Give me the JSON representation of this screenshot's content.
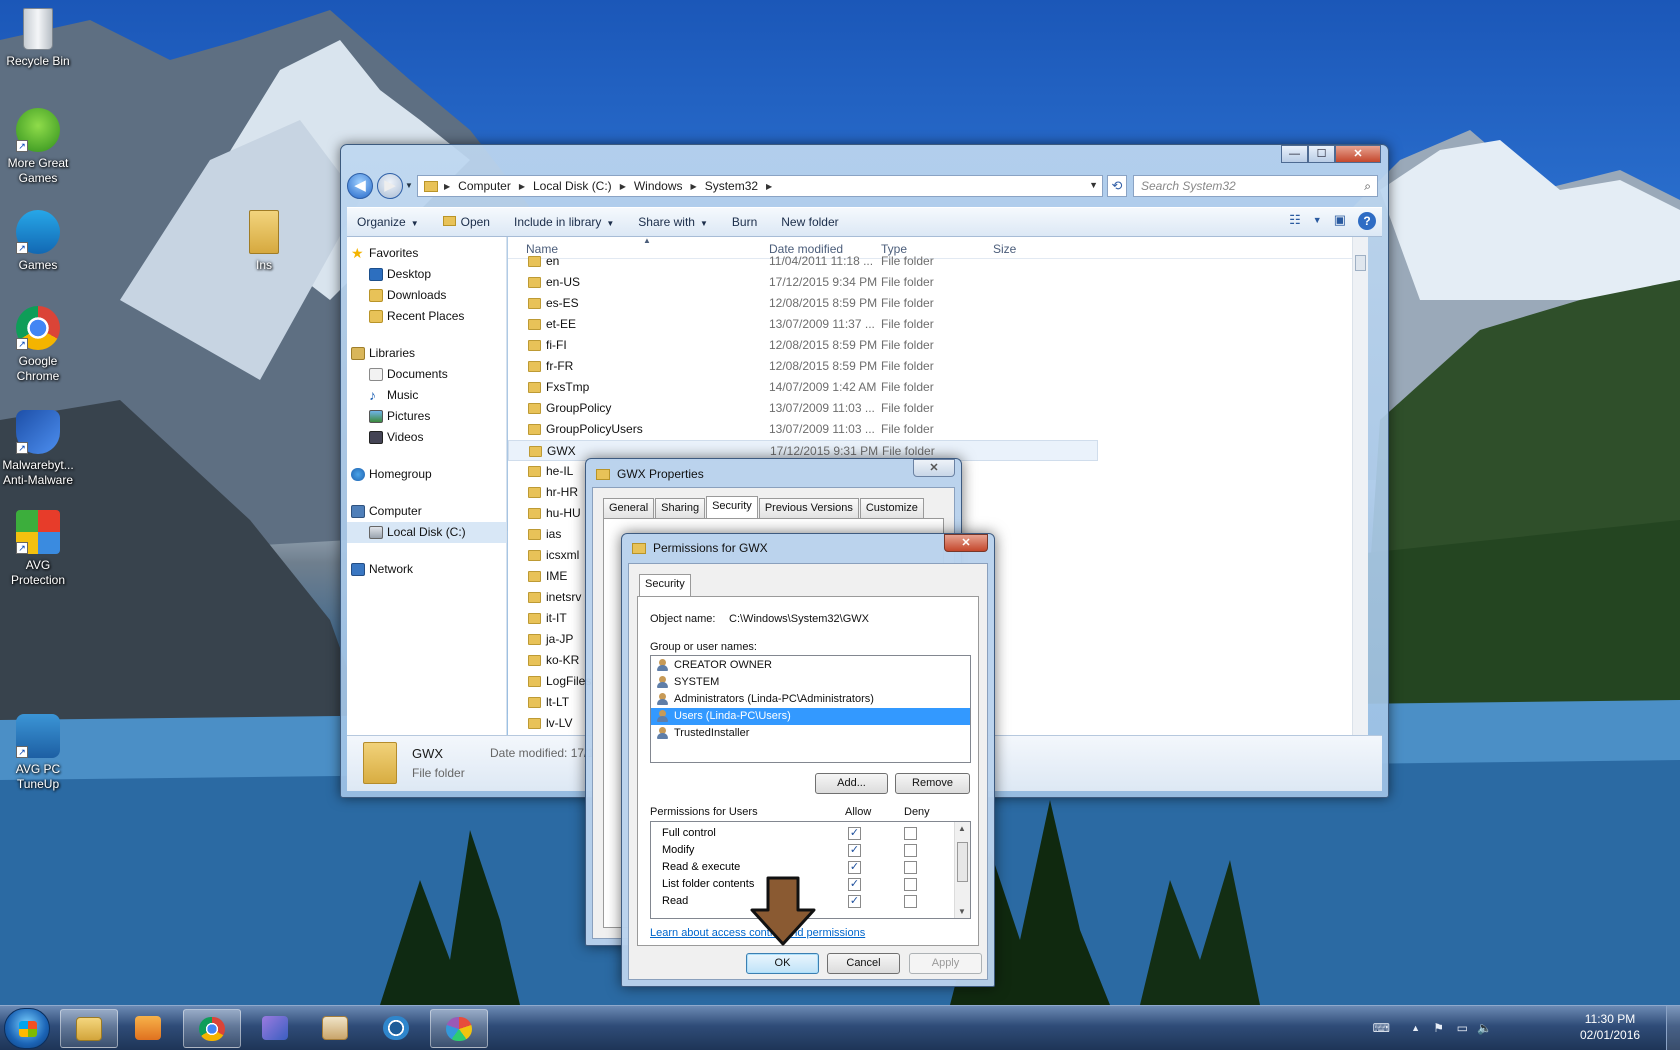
{
  "desktop": {
    "icons": [
      {
        "label": "Recycle Bin",
        "icon": "recycle-bin-icon"
      },
      {
        "label": "More Great Games",
        "icon": "games-shortcut-icon"
      },
      {
        "label": "Games",
        "icon": "bigfish-games-icon"
      },
      {
        "label": "Google Chrome",
        "icon": "chrome-icon"
      },
      {
        "label": "Malwarebyt... Anti-Malware",
        "icon": "malwarebytes-icon"
      },
      {
        "label": "AVG Protection",
        "icon": "avg-icon"
      },
      {
        "label": "AVG PC TuneUp",
        "icon": "tuneup-icon"
      },
      {
        "label": "Ins",
        "icon": "folder-icon"
      }
    ]
  },
  "explorer": {
    "caption": {
      "minimize": "—",
      "maximize": "☐",
      "close": "✕"
    },
    "address": {
      "crumbs": [
        "Computer",
        "Local Disk (C:)",
        "Windows",
        "System32"
      ]
    },
    "search_placeholder": "Search System32",
    "toolbar": {
      "organize": "Organize",
      "open": "Open",
      "include": "Include in library",
      "share": "Share with",
      "burn": "Burn",
      "new_folder": "New folder"
    },
    "nav": {
      "favorites": "Favorites",
      "desktop": "Desktop",
      "downloads": "Downloads",
      "recent": "Recent Places",
      "libraries": "Libraries",
      "documents": "Documents",
      "music": "Music",
      "pictures": "Pictures",
      "videos": "Videos",
      "homegroup": "Homegroup",
      "computer": "Computer",
      "local_disk": "Local Disk (C:)",
      "network": "Network"
    },
    "columns": {
      "name": "Name",
      "date": "Date modified",
      "type": "Type",
      "size": "Size"
    },
    "files": [
      {
        "name": "en",
        "date": "11/04/2011 11:18 ...",
        "type": "File folder"
      },
      {
        "name": "en-US",
        "date": "17/12/2015 9:34 PM",
        "type": "File folder"
      },
      {
        "name": "es-ES",
        "date": "12/08/2015 8:59 PM",
        "type": "File folder"
      },
      {
        "name": "et-EE",
        "date": "13/07/2009 11:37 ...",
        "type": "File folder"
      },
      {
        "name": "fi-FI",
        "date": "12/08/2015 8:59 PM",
        "type": "File folder"
      },
      {
        "name": "fr-FR",
        "date": "12/08/2015 8:59 PM",
        "type": "File folder"
      },
      {
        "name": "FxsTmp",
        "date": "14/07/2009 1:42 AM",
        "type": "File folder"
      },
      {
        "name": "GroupPolicy",
        "date": "13/07/2009 11:03 ...",
        "type": "File folder"
      },
      {
        "name": "GroupPolicyUsers",
        "date": "13/07/2009 11:03 ...",
        "type": "File folder"
      },
      {
        "name": "GWX",
        "date": "17/12/2015 9:31 PM",
        "type": "File folder"
      },
      {
        "name": "he-IL",
        "date": "",
        "type": ""
      },
      {
        "name": "hr-HR",
        "date": "",
        "type": ""
      },
      {
        "name": "hu-HU",
        "date": "",
        "type": ""
      },
      {
        "name": "ias",
        "date": "",
        "type": ""
      },
      {
        "name": "icsxml",
        "date": "",
        "type": ""
      },
      {
        "name": "IME",
        "date": "",
        "type": ""
      },
      {
        "name": "inetsrv",
        "date": "",
        "type": ""
      },
      {
        "name": "it-IT",
        "date": "",
        "type": ""
      },
      {
        "name": "ja-JP",
        "date": "",
        "type": ""
      },
      {
        "name": "ko-KR",
        "date": "",
        "type": ""
      },
      {
        "name": "LogFiles",
        "date": "",
        "type": ""
      },
      {
        "name": "lt-LT",
        "date": "",
        "type": ""
      },
      {
        "name": "lv-LV",
        "date": "",
        "type": ""
      }
    ],
    "details": {
      "name": "GWX",
      "type": "File folder",
      "modified": "Date modified: 17/1"
    }
  },
  "gwx_props": {
    "title": "GWX Properties",
    "tabs": [
      "General",
      "Sharing",
      "Security",
      "Previous Versions",
      "Customize"
    ],
    "active_tab": "Security"
  },
  "perm": {
    "title": "Permissions for GWX",
    "tab": "Security",
    "object_label": "Object name:",
    "object_value": "C:\\Windows\\System32\\GWX",
    "groups_label": "Group or user names:",
    "groups": [
      "CREATOR OWNER",
      "SYSTEM",
      "Administrators (Linda-PC\\Administrators)",
      "Users (Linda-PC\\Users)",
      "TrustedInstaller"
    ],
    "selected_group": "Users (Linda-PC\\Users)",
    "add": "Add...",
    "remove": "Remove",
    "perm_header": "Permissions for Users",
    "allow": "Allow",
    "deny": "Deny",
    "permissions": [
      {
        "name": "Full control",
        "allow": true,
        "deny": false
      },
      {
        "name": "Modify",
        "allow": true,
        "deny": false
      },
      {
        "name": "Read & execute",
        "allow": true,
        "deny": false
      },
      {
        "name": "List folder contents",
        "allow": true,
        "deny": false
      },
      {
        "name": "Read",
        "allow": true,
        "deny": false
      }
    ],
    "learn_link": "Learn about access control and permissions",
    "ok": "OK",
    "cancel": "Cancel",
    "apply": "Apply"
  },
  "taskbar": {
    "apps": [
      "windows-explorer-icon",
      "media-player-icon",
      "chrome-icon",
      "win-app-icon",
      "game-app-icon",
      "tuneup-icon",
      "paint-icon"
    ],
    "time": "11:30 PM",
    "date": "02/01/2016"
  },
  "colors": {
    "selection": "#3399ff",
    "arrow": "#8a5a32"
  }
}
